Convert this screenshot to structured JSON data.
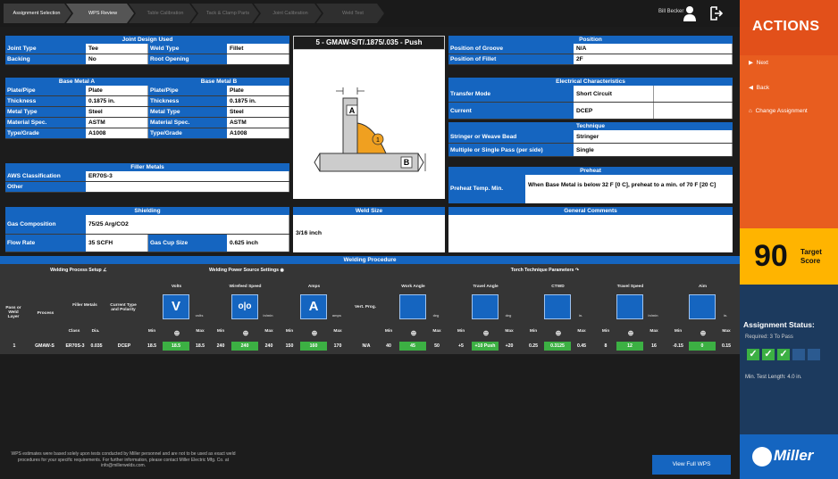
{
  "breadcrumb": [
    {
      "label": "Assignment Selection",
      "state": "done"
    },
    {
      "label": "WPS Review",
      "state": "active"
    },
    {
      "label": "Table Calibration",
      "state": "todo"
    },
    {
      "label": "Tack & Clamp Parts",
      "state": "todo"
    },
    {
      "label": "Joint Calibration",
      "state": "todo"
    },
    {
      "label": "Weld Test",
      "state": "todo"
    }
  ],
  "user": {
    "name": "Bill Becker"
  },
  "joint_design": {
    "header": "Joint Design Used",
    "rows": [
      {
        "k1": "Joint Type",
        "v1": "Tee",
        "k2": "Weld Type",
        "v2": "Fillet"
      },
      {
        "k1": "Backing",
        "v1": "No",
        "k2": "Root Opening",
        "v2": ""
      }
    ]
  },
  "base_metal_a": {
    "header": "Base Metal A",
    "rows": [
      {
        "k": "Plate/Pipe",
        "v": "Plate"
      },
      {
        "k": "Thickness",
        "v": "0.1875 in."
      },
      {
        "k": "Metal Type",
        "v": "Steel"
      },
      {
        "k": "Material Spec.",
        "v": "ASTM"
      },
      {
        "k": "Type/Grade",
        "v": "A1008"
      }
    ]
  },
  "base_metal_b": {
    "header": "Base Metal B",
    "rows": [
      {
        "k": "Plate/Pipe",
        "v": "Plate"
      },
      {
        "k": "Thickness",
        "v": "0.1875 in."
      },
      {
        "k": "Metal Type",
        "v": "Steel"
      },
      {
        "k": "Material Spec.",
        "v": "ASTM"
      },
      {
        "k": "Type/Grade",
        "v": "A1008"
      }
    ]
  },
  "filler_metals": {
    "header": "Filler Metals",
    "rows": [
      {
        "k": "AWS Classification",
        "v": "ER70S-3"
      },
      {
        "k": "Other",
        "v": ""
      }
    ]
  },
  "shielding": {
    "header": "Shielding",
    "gas_composition_label": "Gas Composition",
    "gas_composition": "75/25 Arg/CO2",
    "flow_rate_label": "Flow Rate",
    "flow_rate": "35 SCFH",
    "gas_cup_label": "Gas Cup Size",
    "gas_cup": "0.625 inch"
  },
  "weld_image": {
    "title": "5 - GMAW-S/T/.1875/.035 - Push",
    "label_a": "A",
    "label_b": "B",
    "marker": "1"
  },
  "weld_size": {
    "header": "Weld Size",
    "value": "3/16 inch"
  },
  "position": {
    "header": "Position",
    "rows": [
      {
        "k": "Position of Groove",
        "v": "N/A"
      },
      {
        "k": "Position of Fillet",
        "v": "2F"
      }
    ]
  },
  "electrical": {
    "header": "Electrical Characteristics",
    "rows": [
      {
        "k": "Transfer Mode",
        "v": "Short Circuit"
      },
      {
        "k": "Current",
        "v": "DCEP"
      }
    ]
  },
  "technique": {
    "header": "Technique",
    "rows": [
      {
        "k": "Stringer or Weave Bead",
        "v": "Stringer"
      },
      {
        "k": "Multiple or Single Pass (per side)",
        "v": "Single"
      }
    ]
  },
  "preheat": {
    "header": "Preheat",
    "label": "Preheat Temp. Min.",
    "value": "When Base Metal is below 32 F [0 C], preheat to a min. of 70 F [20 C]"
  },
  "general_comments": {
    "header": "General Comments"
  },
  "procedure": {
    "header": "Welding Procedure",
    "process_setup": "Welding Process Setup",
    "power_source": "Welding Power Source Settings",
    "torch": "Torch Technique Parameters",
    "col_pass": "Pass or Weld Layer",
    "col_process": "Process",
    "col_filler": "Filler Metals",
    "col_class": "Class",
    "col_dia": "Dia.",
    "col_current": "Current Type and Polarity",
    "col_vert": "Vert. Prog.",
    "groups": [
      {
        "title": "Volts",
        "glyph": "V",
        "unit": "volts"
      },
      {
        "title": "Wirefeed Speed",
        "glyph": "o|o",
        "unit": "in/min"
      },
      {
        "title": "Amps",
        "glyph": "A",
        "unit": "amps"
      },
      {
        "title": "Work Angle",
        "glyph": "",
        "unit": "deg"
      },
      {
        "title": "Travel Angle",
        "glyph": "",
        "unit": "deg"
      },
      {
        "title": "CTWD",
        "glyph": "",
        "unit": "in."
      },
      {
        "title": "Travel Speed",
        "glyph": "",
        "unit": "in/min"
      },
      {
        "title": "Aim",
        "glyph": "",
        "unit": "in."
      }
    ],
    "min_label": "Min",
    "max_label": "Max",
    "row": {
      "pass": "1",
      "process": "GMAW-S",
      "class": "ER70S-3",
      "dia": "0.035",
      "current": "DCEP",
      "volts": [
        "18.5",
        "18.5",
        "18.5"
      ],
      "wfs": [
        "240",
        "240",
        "240"
      ],
      "amps": [
        "150",
        "160",
        "170"
      ],
      "vert": "N/A",
      "work_angle": [
        "40",
        "45",
        "50"
      ],
      "travel_angle": [
        "+5",
        "+10 Push",
        "+20"
      ],
      "ctwd": [
        "0.25",
        "0.3125",
        "0.45"
      ],
      "travel_speed": [
        "8",
        "12",
        "16"
      ],
      "aim": [
        "-0.15",
        "0",
        "0.15"
      ]
    }
  },
  "disclaimer": "WPS estimates were based solely upon tests conducted by Miller personnel and are not to be used as exact weld procedures for your specific requirements. For further information, please contact Miller Electric Mfg. Co. at info@millerwelds.com.",
  "view_full_wps": "View Full WPS",
  "panel": {
    "title": "ACTIONS",
    "next": "Next",
    "back": "Back",
    "change": "Change Assignment",
    "score": "90",
    "score_label_1": "Target",
    "score_label_2": "Score",
    "status_title": "Assignment Status:",
    "required": "Required: 3 To Pass",
    "checks": [
      true,
      true,
      true,
      false,
      false
    ],
    "min_length": "Min. Test Length: 4.0 in.",
    "brand": "Miller"
  },
  "colors": {
    "accent": "#1565c0",
    "orange": "#e85d1f",
    "score": "#ffb400",
    "green": "#3cb043"
  }
}
